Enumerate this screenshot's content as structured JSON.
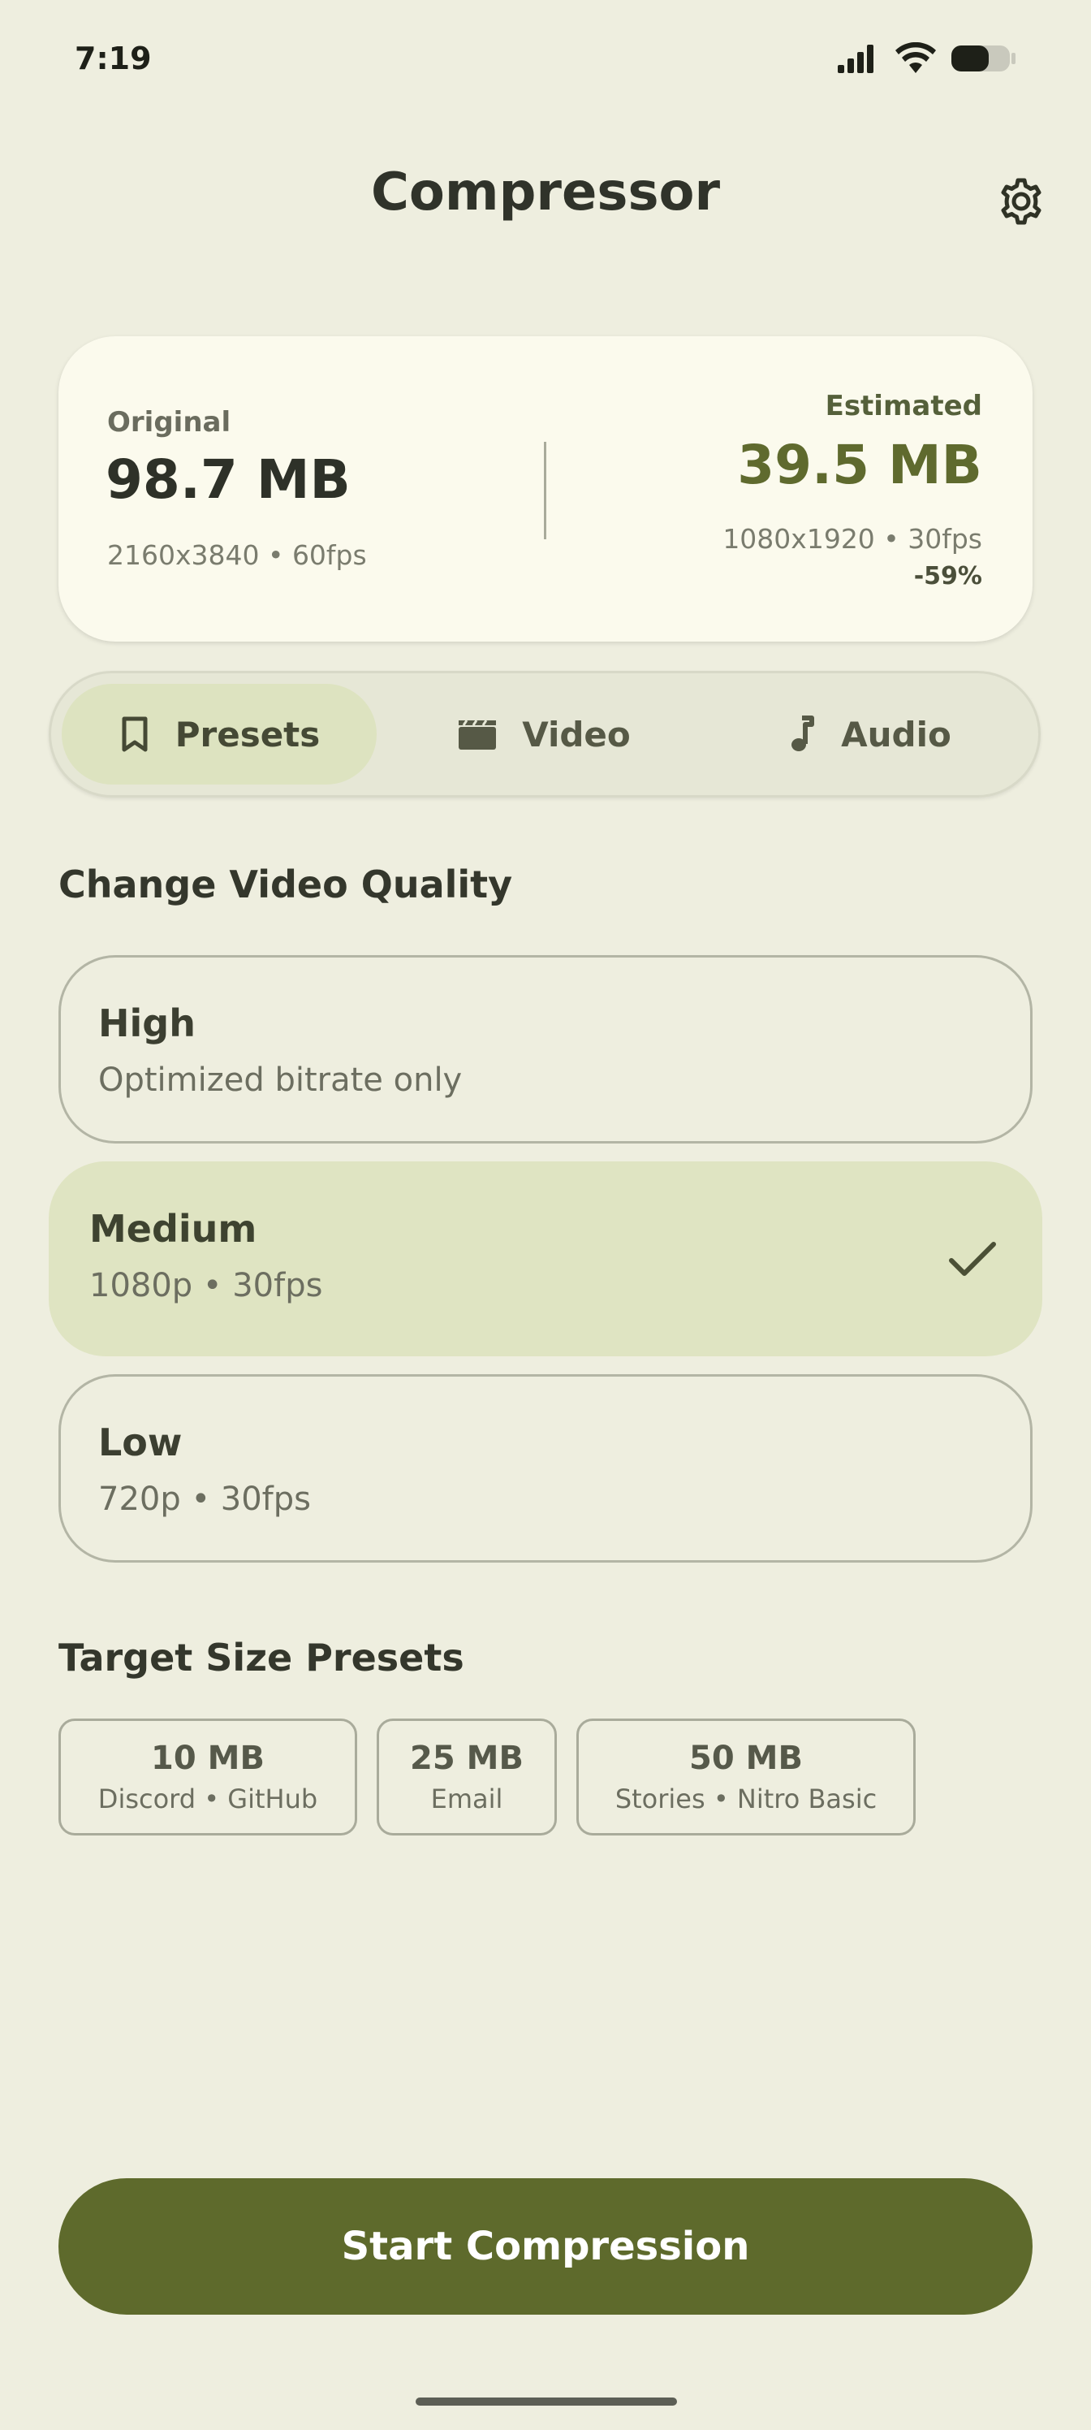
{
  "status_bar": {
    "time": "7:19",
    "icons": [
      "signal-icon",
      "wifi-icon",
      "battery-icon"
    ]
  },
  "header": {
    "title": "Compressor",
    "settings_icon": "gear-icon"
  },
  "size_card": {
    "original": {
      "label": "Original",
      "size": "98.7 MB",
      "meta": "2160x3840 • 60fps"
    },
    "estimated": {
      "label": "Estimated",
      "size": "39.5 MB",
      "meta": "1080x1920 • 30fps",
      "reduction": "-59%"
    }
  },
  "tabs": [
    {
      "label": "Presets",
      "icon": "bookmark-icon",
      "active": true
    },
    {
      "label": "Video",
      "icon": "clapperboard-icon",
      "active": false
    },
    {
      "label": "Audio",
      "icon": "music-note-icon",
      "active": false
    }
  ],
  "quality": {
    "title": "Change Video Quality",
    "options": [
      {
        "label": "High",
        "detail": "Optimized bitrate only",
        "selected": false
      },
      {
        "label": "Medium",
        "detail": "1080p • 30fps",
        "selected": true
      },
      {
        "label": "Low",
        "detail": "720p • 30fps",
        "selected": false
      }
    ]
  },
  "target_presets": {
    "title": "Target Size Presets",
    "chips": [
      {
        "size": "10 MB",
        "detail": "Discord • GitHub"
      },
      {
        "size": "25 MB",
        "detail": "Email"
      },
      {
        "size": "50 MB",
        "detail": "Stories • Nitro Basic"
      }
    ]
  },
  "primary_action": {
    "label": "Start Compression"
  },
  "colors": {
    "background": "#eeeedf",
    "card": "#fbfaed",
    "accent": "#5e6a2c",
    "selected_fill": "#dfe4c2"
  }
}
